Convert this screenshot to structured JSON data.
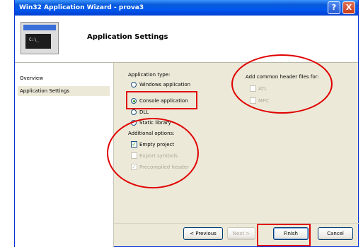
{
  "window": {
    "title": "Win32 Application Wizard - prova3"
  },
  "title_buttons": {
    "help": "?",
    "close": "X"
  },
  "header": {
    "title": "Application Settings",
    "icon_text": "C:\\_"
  },
  "sidebar": {
    "items": [
      {
        "label": "Overview"
      },
      {
        "label": "Application Settings"
      }
    ]
  },
  "application_type": {
    "label": "Application type:",
    "options": [
      {
        "label": "Windows application"
      },
      {
        "label": "Console application"
      },
      {
        "label": "DLL"
      },
      {
        "label": "Static library"
      }
    ]
  },
  "additional_options": {
    "label": "Additional options:",
    "options": [
      {
        "label": "Empty project"
      },
      {
        "label": "Export symbols"
      },
      {
        "label": "Precompiled header"
      }
    ]
  },
  "common_headers": {
    "label": "Add common header files for:",
    "options": [
      {
        "label": "ATL"
      },
      {
        "label": "MFC"
      }
    ]
  },
  "buttons": {
    "previous": "< Previous",
    "next": "Next >",
    "finish": "Finish",
    "cancel": "Cancel"
  },
  "colors": {
    "annotation": "#e00000",
    "titlebar": "#0058ee",
    "dialog_bg": "#ece9d8"
  }
}
